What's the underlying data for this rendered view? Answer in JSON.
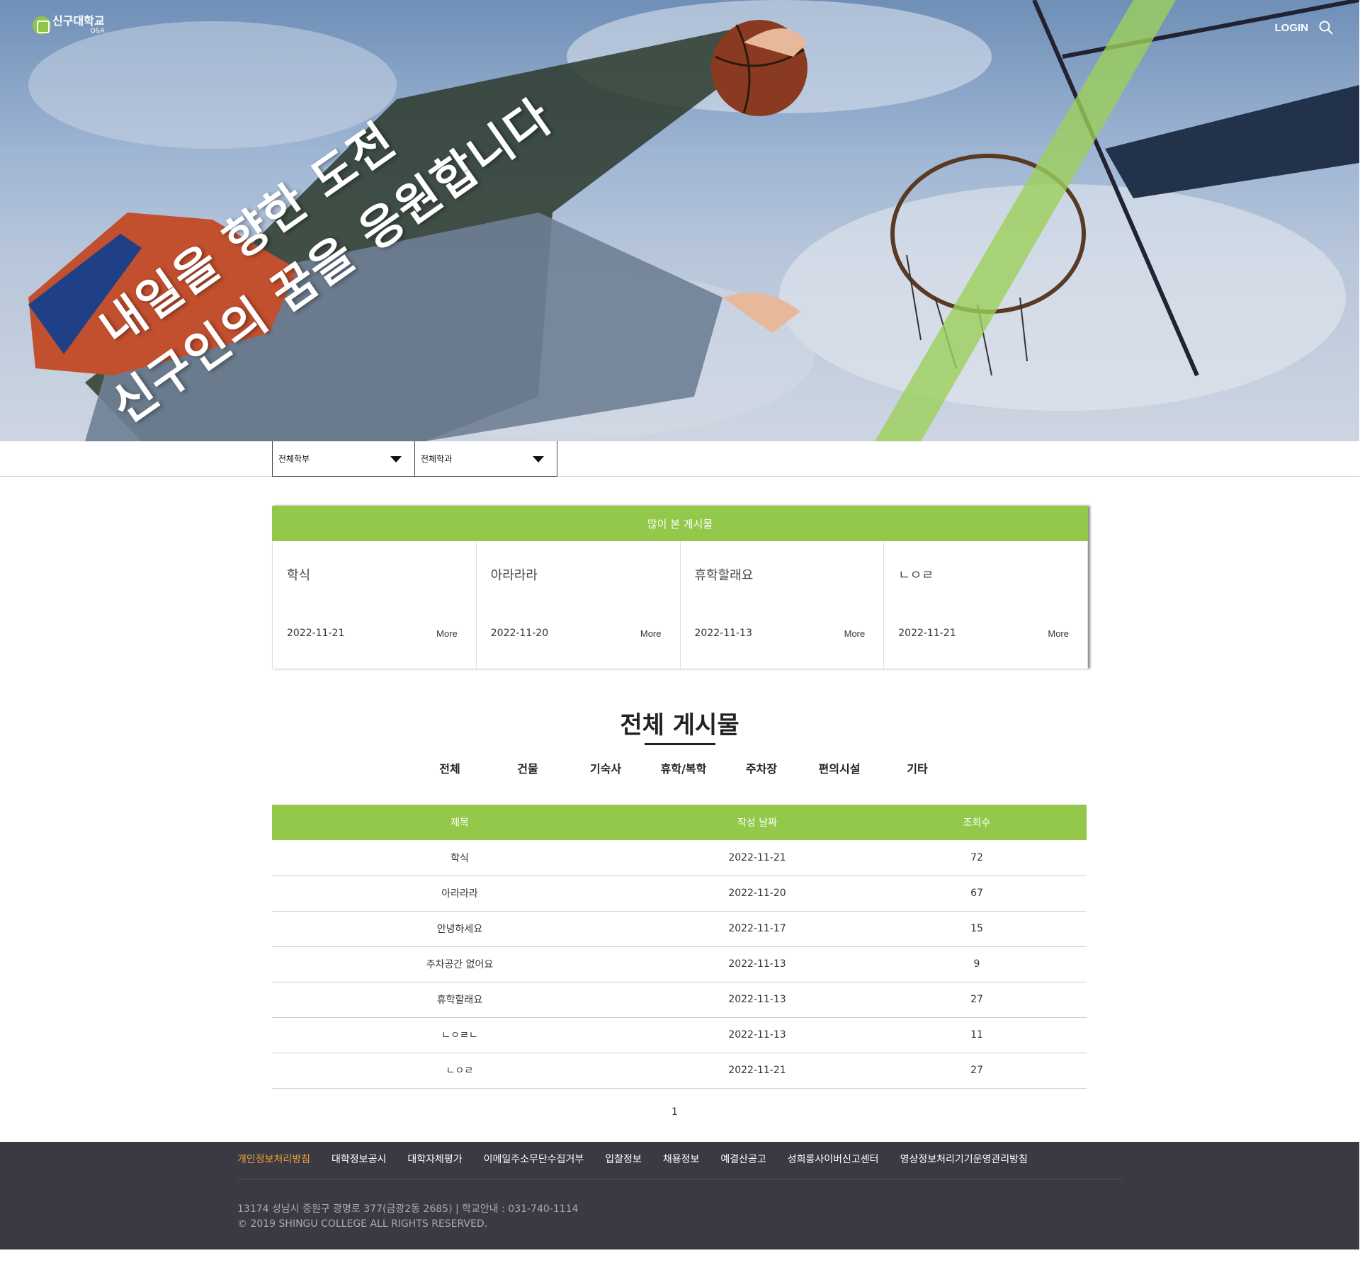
{
  "header": {
    "logo_main": "신구대학교",
    "logo_sub": "Q&A",
    "login_label": "LOGIN",
    "search_icon": "search-icon"
  },
  "hero": {
    "line1": "내일을 향한 도전",
    "line2": "신구인의 꿈을 응원합니다"
  },
  "filters": {
    "division": "전체학부",
    "department": "전체학과"
  },
  "popular": {
    "heading": "많이 본 게시물",
    "cards": [
      {
        "title": "학식",
        "date": "2022-11-21",
        "more": "More"
      },
      {
        "title": "아라라라",
        "date": "2022-11-20",
        "more": "More"
      },
      {
        "title": "휴학할래요",
        "date": "2022-11-13",
        "more": "More"
      },
      {
        "title": "ㄴㅇㄹ",
        "date": "2022-11-21",
        "more": "More"
      }
    ]
  },
  "board": {
    "title": "전체 게시물",
    "categories": [
      "전체",
      "건물",
      "기숙사",
      "휴학/복학",
      "주차장",
      "편의시설",
      "기타"
    ],
    "columns": [
      "제목",
      "작성 날짜",
      "조회수"
    ],
    "rows": [
      {
        "title": "학식",
        "date": "2022-11-21",
        "views": "72"
      },
      {
        "title": "아라라라",
        "date": "2022-11-20",
        "views": "67"
      },
      {
        "title": "안녕하세요",
        "date": "2022-11-17",
        "views": "15"
      },
      {
        "title": "주차공간 없어요",
        "date": "2022-11-13",
        "views": "9"
      },
      {
        "title": "휴학할래요",
        "date": "2022-11-13",
        "views": "27"
      },
      {
        "title": "ㄴㅇㄹㄴ",
        "date": "2022-11-13",
        "views": "11"
      },
      {
        "title": "ㄴㅇㄹ",
        "date": "2022-11-21",
        "views": "27"
      }
    ],
    "page": "1"
  },
  "footer": {
    "links": [
      "개인정보처리방침",
      "대학정보공시",
      "대학자체평가",
      "이메일주소무단수집거부",
      "입찰정보",
      "채용정보",
      "예결산공고",
      "성희롱사이버신고센터",
      "영상정보처리기기운영관리방침"
    ],
    "address": "13174 성남시 중원구 광명로 377(금광2동 2685) | 학교안내 : 031-740-1114",
    "copyright": "© 2019 SHINGU COLLEGE ALL RIGHTS RESERVED."
  },
  "colors": {
    "accent": "#93c84b",
    "footer_bg": "#3a3a45",
    "footer_highlight": "#f0a030"
  }
}
